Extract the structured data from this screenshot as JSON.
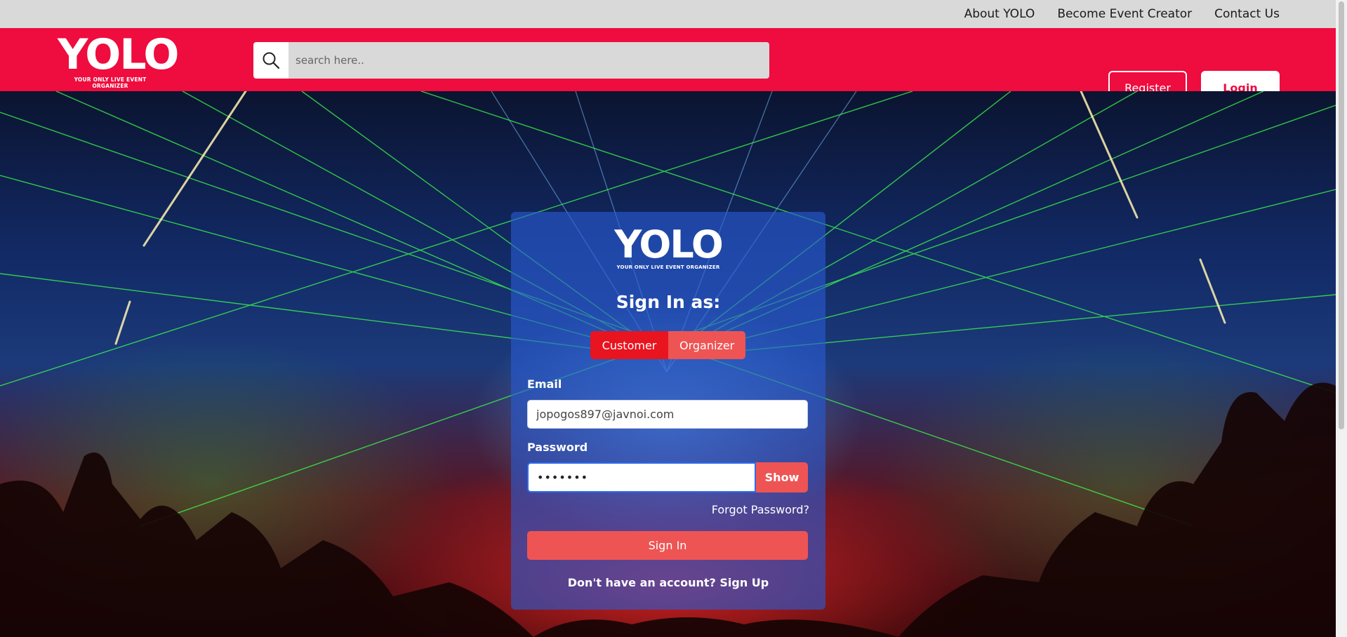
{
  "topbar": {
    "links": [
      "About YOLO",
      "Become Event Creator",
      "Contact Us"
    ]
  },
  "header": {
    "logo_text": "YOLO",
    "logo_tagline": "YOUR ONLY LIVE EVENT ORGANIZER",
    "search_placeholder": "search here..",
    "register_label": "Register",
    "login_label": "Login",
    "brand_color": "#ef0c3e"
  },
  "login_card": {
    "logo_text": "YOLO",
    "logo_tagline": "YOUR ONLY LIVE EVENT ORGANIZER",
    "title": "Sign In as:",
    "roles": [
      "Customer",
      "Organizer"
    ],
    "selected_role": "Customer",
    "email_label": "Email",
    "email_value": "jopogos897@javnoi.com",
    "password_label": "Password",
    "password_value": "•••••••",
    "show_label": "Show",
    "forgot_label": "Forgot Password?",
    "signin_label": "Sign In",
    "signup_text": "Don't have an account? Sign Up",
    "button_color": "#ee5454"
  },
  "icons": {
    "search": "search-icon"
  }
}
